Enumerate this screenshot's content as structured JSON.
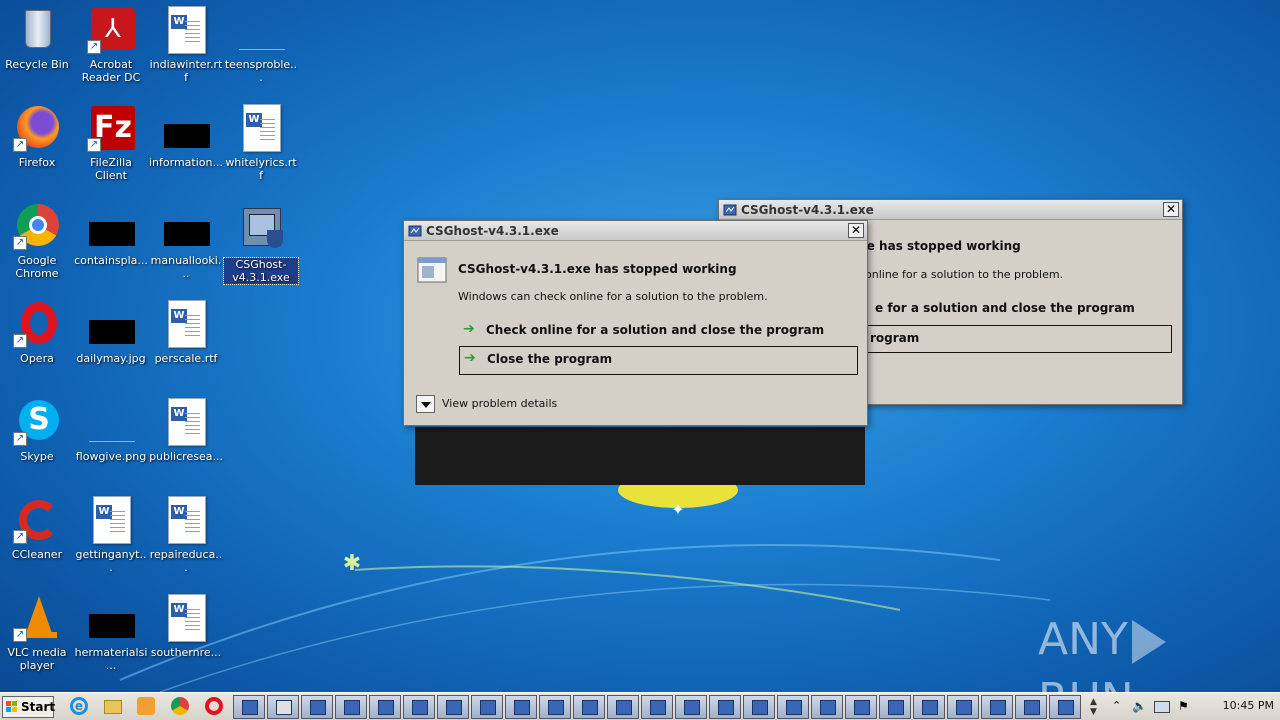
{
  "desktop_icons": [
    {
      "label": "Recycle Bin"
    },
    {
      "label": "Acrobat Reader DC"
    },
    {
      "label": "indiawinter.rtf"
    },
    {
      "label": "teensproble..."
    },
    {
      "label": "Firefox"
    },
    {
      "label": "FileZilla Client"
    },
    {
      "label": "information..."
    },
    {
      "label": "whitelyrics.rtf"
    },
    {
      "label": "Google Chrome"
    },
    {
      "label": "containspla..."
    },
    {
      "label": "manuallooki..."
    },
    {
      "label": "CSGhost-v4.3.1.exe"
    },
    {
      "label": "Opera"
    },
    {
      "label": "dailymay.jpg"
    },
    {
      "label": "perscale.rtf"
    },
    {
      "label": "Skype"
    },
    {
      "label": "flowgive.png"
    },
    {
      "label": "publicresea..."
    },
    {
      "label": "CCleaner"
    },
    {
      "label": "gettinganyt..."
    },
    {
      "label": "repaireduca..."
    },
    {
      "label": "VLC media player"
    },
    {
      "label": "hermaterialsi..."
    },
    {
      "label": "southernre..."
    }
  ],
  "back_dialog": {
    "title": "CSGhost-v4.3.1.exe",
    "heading_partial": "xe has stopped working",
    "sub_partial": "online for a solution to the problem.",
    "option1_partial": "e for a solution and close the program",
    "option2_partial": "rogram"
  },
  "front_dialog": {
    "title": "CSGhost-v4.3.1.exe",
    "heading": "CSGhost-v4.3.1.exe has stopped working",
    "sub": "Windows can check online for a solution to the problem.",
    "option1": "Check online for a solution and close the program",
    "option2": "Close the program",
    "details": "View problem details",
    "close_glyph": "✕"
  },
  "watermark": {
    "text_left": "ANY",
    "text_right": "RUN"
  },
  "taskbar": {
    "start_label": "Start",
    "clock": "10:45 PM",
    "task_button_count": 23
  },
  "colors": {
    "desktop_blue": "#1c7fd0",
    "dialog_bg": "#d4d0c8",
    "green_arrow": "#2f9a2f",
    "selection_blue": "#1e3d8a"
  }
}
